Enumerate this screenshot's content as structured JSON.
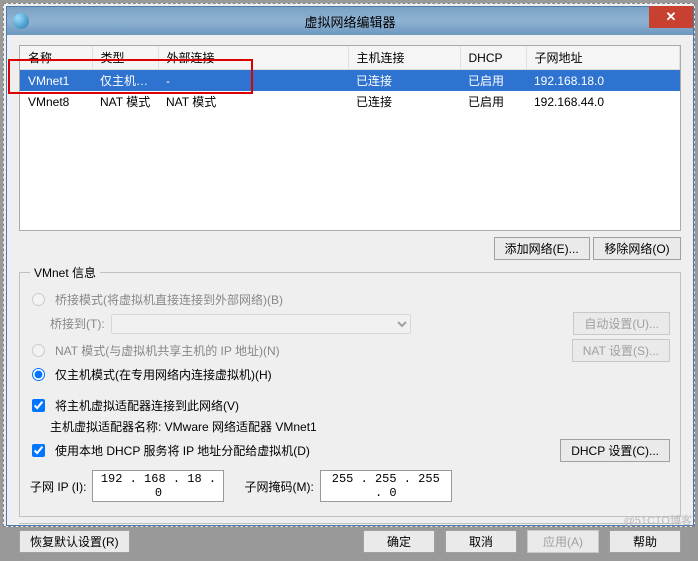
{
  "window": {
    "title": "虚拟网络编辑器",
    "close_glyph": "✕"
  },
  "table": {
    "headers": {
      "name": "名称",
      "type": "类型",
      "external": "外部连接",
      "host": "主机连接",
      "dhcp": "DHCP",
      "subnet": "子网地址"
    },
    "rows": [
      {
        "name": "VMnet1",
        "type": "仅主机…",
        "external": "-",
        "host": "已连接",
        "dhcp": "已启用",
        "subnet": "192.168.18.0",
        "selected": true
      },
      {
        "name": "VMnet8",
        "type": "NAT 模式",
        "external": "NAT 模式",
        "host": "已连接",
        "dhcp": "已启用",
        "subnet": "192.168.44.0",
        "selected": false
      }
    ]
  },
  "buttons": {
    "add_network": "添加网络(E)...",
    "remove_network": "移除网络(O)",
    "auto_settings": "自动设置(U)...",
    "nat_settings": "NAT 设置(S)...",
    "dhcp_settings": "DHCP 设置(C)...",
    "restore_defaults": "恢复默认设置(R)",
    "ok": "确定",
    "cancel": "取消",
    "apply": "应用(A)",
    "help": "帮助"
  },
  "vmnet_info": {
    "legend": "VMnet 信息",
    "bridged_label": "桥接模式(将虚拟机直接连接到外部网络)(B)",
    "bridged_to_label": "桥接到(T):",
    "bridged_to_value": "",
    "nat_label": "NAT 模式(与虚拟机共享主机的 IP 地址)(N)",
    "host_only_label": "仅主机模式(在专用网络内连接虚拟机)(H)",
    "connect_adapter_label": "将主机虚拟适配器连接到此网络(V)",
    "adapter_name_label": "主机虚拟适配器名称: VMware 网络适配器 VMnet1",
    "use_dhcp_label": "使用本地 DHCP 服务将 IP 地址分配给虚拟机(D)",
    "subnet_ip_label": "子网 IP (I):",
    "subnet_ip_value": "192 . 168 . 18  .  0",
    "subnet_mask_label": "子网掩码(M):",
    "subnet_mask_value": "255 . 255 . 255 .  0"
  },
  "watermark": "@51CTO博客"
}
